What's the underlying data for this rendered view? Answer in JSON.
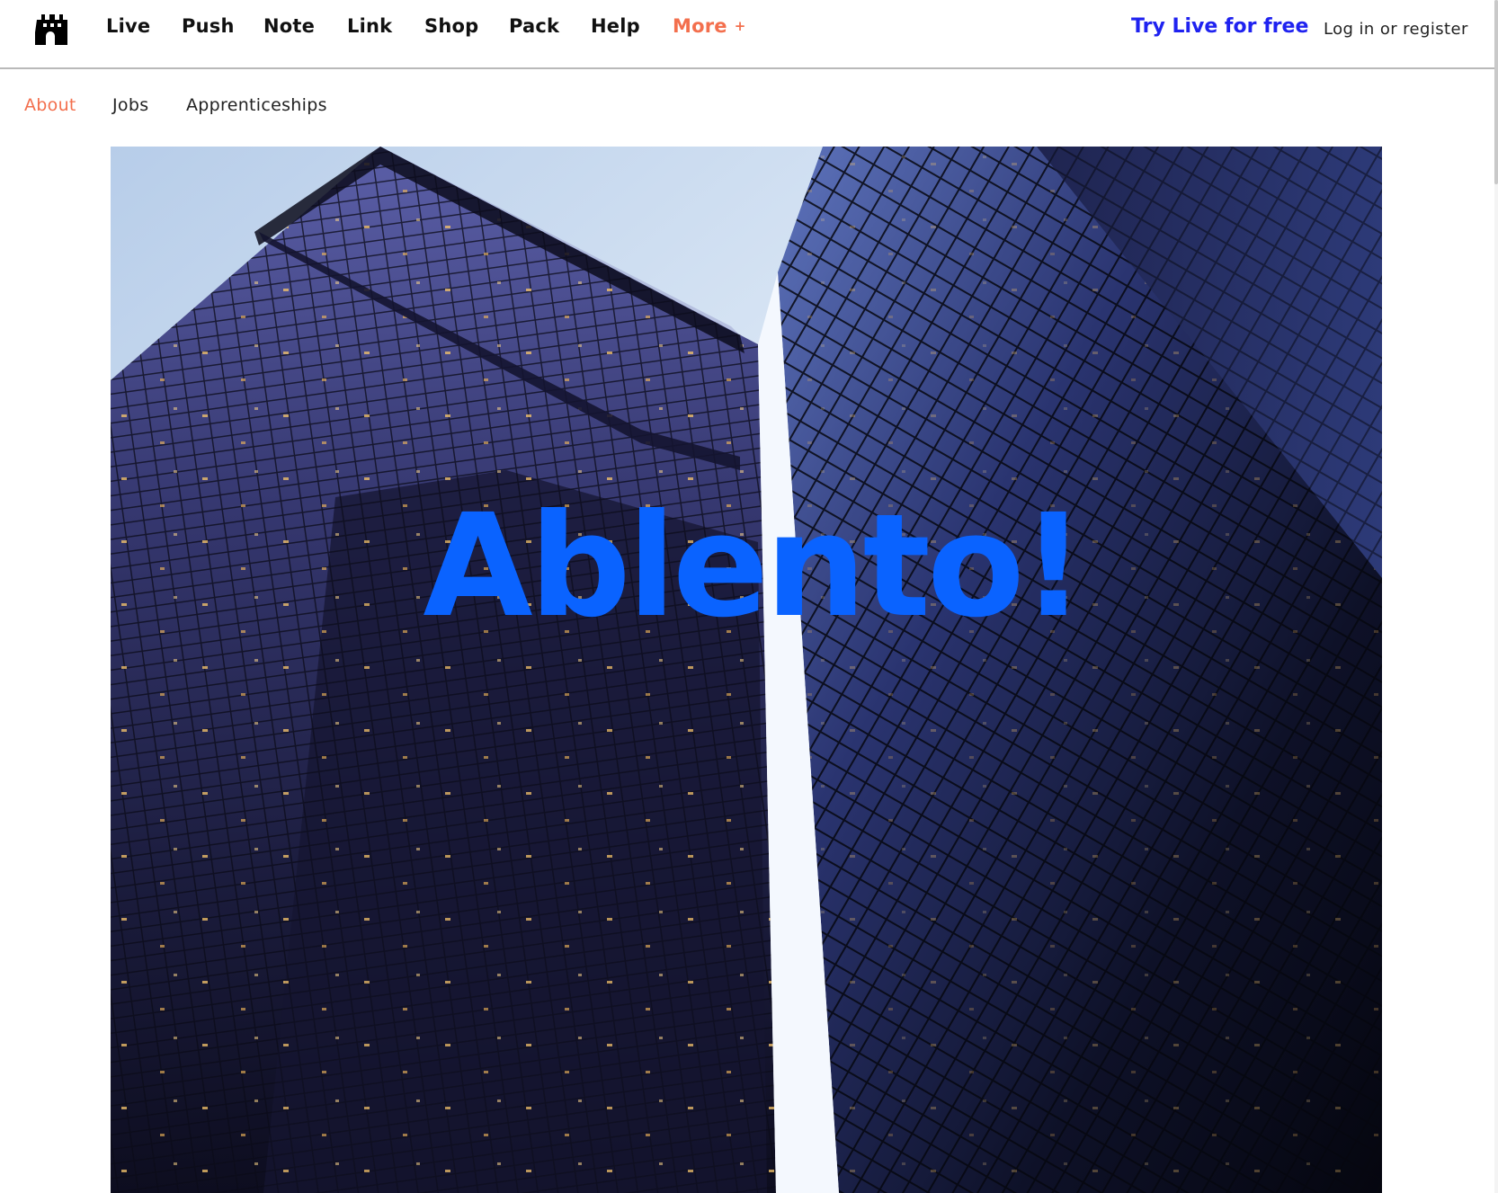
{
  "logo": {
    "icon": "castle-icon"
  },
  "nav": {
    "items": [
      {
        "label": "Live"
      },
      {
        "label": "Push"
      },
      {
        "label": "Note"
      },
      {
        "label": "Link"
      },
      {
        "label": "Shop"
      },
      {
        "label": "Pack"
      },
      {
        "label": "Help"
      }
    ],
    "more_label": "More",
    "more_icon": "+"
  },
  "cta": {
    "try_live": "Try Live for free",
    "login": "Log in",
    "or": "or",
    "register": "register"
  },
  "subnav": {
    "items": [
      {
        "label": "About",
        "active": true
      },
      {
        "label": "Jobs",
        "active": false
      },
      {
        "label": "Apprenticeships",
        "active": false
      }
    ]
  },
  "hero": {
    "title": "Ablento!",
    "image": "skyscrapers-looking-up-photo"
  },
  "colors": {
    "accent": "#f36f4d",
    "cta": "#1f22f0",
    "hero_title": "#0a63ff",
    "sky": "#e6f0fb",
    "building": "#1a1b3c"
  }
}
